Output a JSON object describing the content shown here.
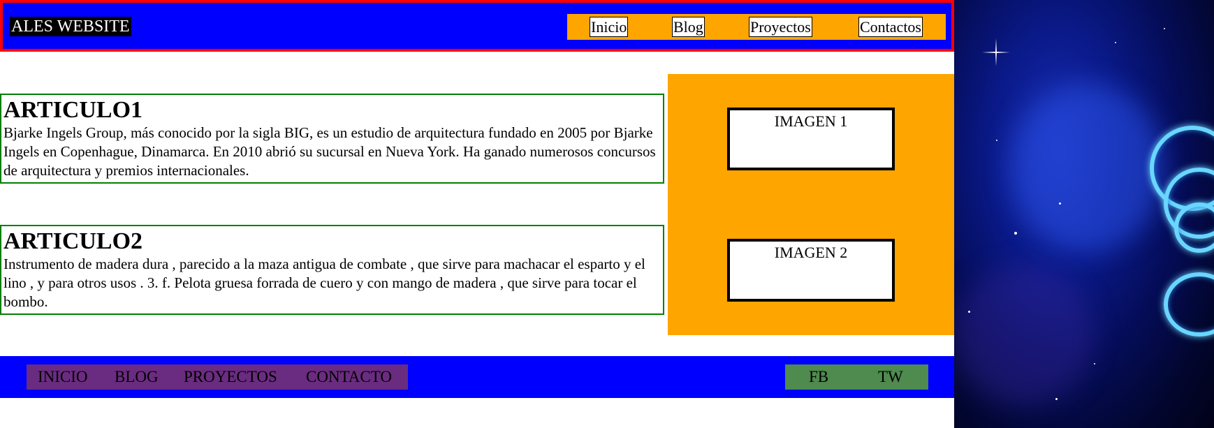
{
  "header": {
    "site_title": "ALES WEBSITE",
    "nav": [
      {
        "label": "Inicio"
      },
      {
        "label": "Blog"
      },
      {
        "label": "Proyectos"
      },
      {
        "label": "Contactos"
      }
    ]
  },
  "articles": [
    {
      "title": "ARTICULO1",
      "body": "Bjarke Ingels Group, más conocido por la sigla BIG, es un estudio de arquitectura fundado en 2005 por Bjarke Ingels en Copenhague, Dinamarca. En 2010 abrió su sucursal en Nueva York. Ha ganado numerosos concursos de arquitectura y premios internacionales."
    },
    {
      "title": "ARTICULO2",
      "body": "Instrumento de madera dura , parecido a la maza antigua de combate , que sirve para machacar el esparto y el lino , y para otros usos . 3. f. Pelota gruesa forrada de cuero y con mango de madera , que sirve para tocar el bombo."
    }
  ],
  "aside": {
    "images": [
      {
        "label": "IMAGEN 1"
      },
      {
        "label": "IMAGEN 2"
      }
    ]
  },
  "footer": {
    "menu": [
      {
        "label": "INICIO"
      },
      {
        "label": "BLOG"
      },
      {
        "label": "PROYECTOS"
      },
      {
        "label": "CONTACTO"
      }
    ],
    "social": [
      {
        "label": "FB"
      },
      {
        "label": "TW"
      }
    ]
  },
  "colors": {
    "header_bg": "#0000ff",
    "header_border": "#ff0000",
    "nav_bg": "#ffa500",
    "article_border": "#008000",
    "aside_bg": "#ffa500",
    "footer_bg": "#0000ff",
    "footer_menu_bg": "#6a2c80",
    "social_bg": "#4f8a4f"
  }
}
